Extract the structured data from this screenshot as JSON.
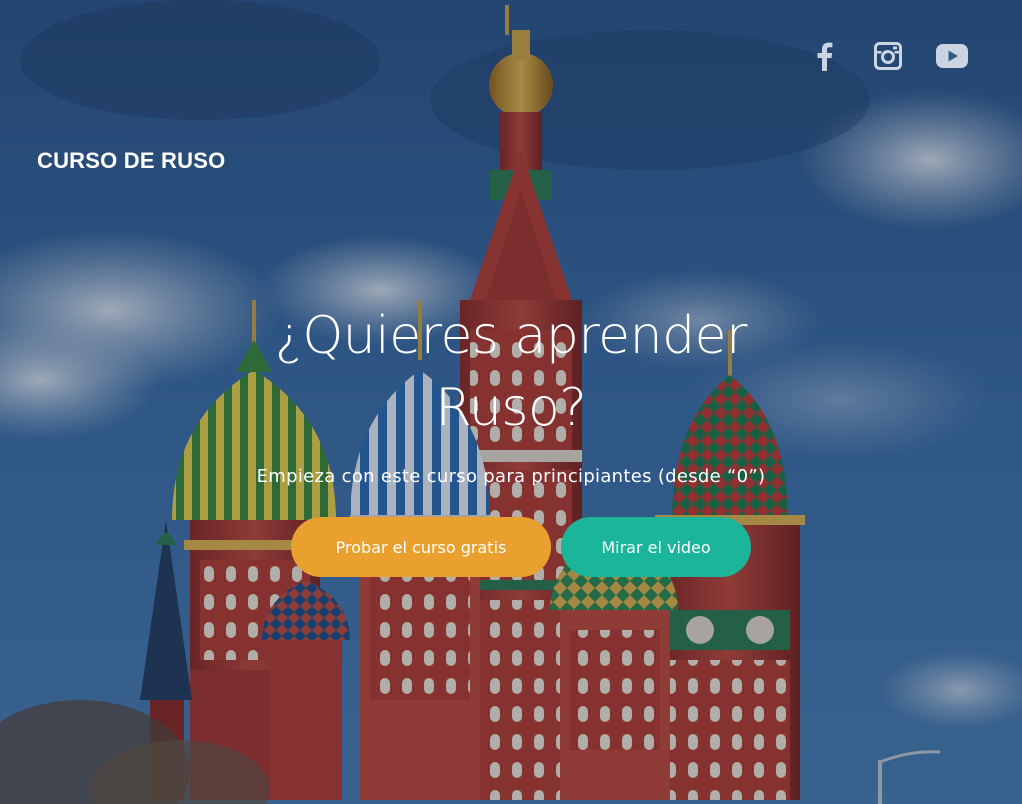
{
  "brand": {
    "logo_text": "CURSO DE RUSO"
  },
  "social": {
    "links": [
      {
        "icon": "facebook-icon"
      },
      {
        "icon": "instagram-icon"
      },
      {
        "icon": "youtube-icon"
      }
    ],
    "icon_color": "#e8eef5"
  },
  "hero": {
    "headline": "¿Quieres aprender Ruso?",
    "subheadline": "Empieza con este curso para principiantes (desde “0”)",
    "buttons": {
      "try_label": "Probar el curso gratis",
      "video_label": "Mirar el video"
    },
    "colors": {
      "try_button": "#e9a02e",
      "video_button": "#1bb59a"
    },
    "background_image": "saint-basils-cathedral"
  }
}
